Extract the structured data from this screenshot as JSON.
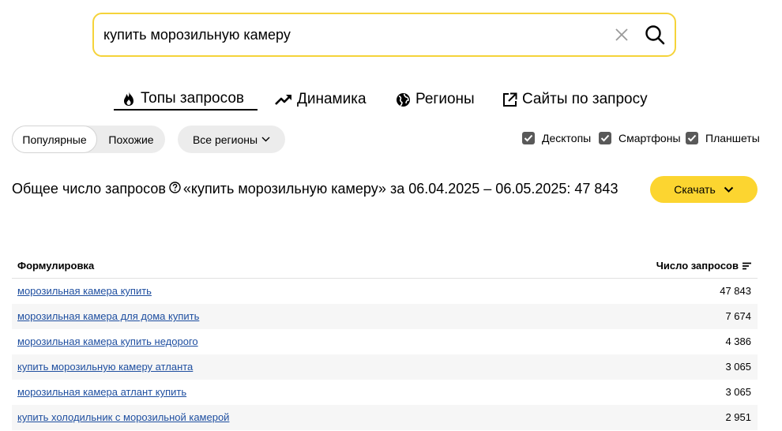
{
  "search": {
    "value": "купить морозильную камеру"
  },
  "tabs": [
    {
      "label": "Топы запросов",
      "icon": "flame-icon"
    },
    {
      "label": "Динамика",
      "icon": "trend-icon"
    },
    {
      "label": "Регионы",
      "icon": "globe-icon"
    },
    {
      "label": "Сайты по запросу",
      "icon": "external-link-icon"
    }
  ],
  "filters": {
    "popular": "Популярные",
    "similar": "Похожие",
    "regions": "Все регионы"
  },
  "devices": [
    {
      "label": "Десктопы",
      "checked": true
    },
    {
      "label": "Смартфоны",
      "checked": true
    },
    {
      "label": "Планшеты",
      "checked": true
    }
  ],
  "total": {
    "prefix": "Общее число запросов",
    "suffix": "«купить морозильную камеру» за 06.04.2025 – 06.05.2025: 47 843"
  },
  "download": {
    "label": "Скачать"
  },
  "table": {
    "col_phrase": "Формулировка",
    "col_count": "Число запросов",
    "rows": [
      {
        "phrase": "морозильная камера купить",
        "count": "47 843"
      },
      {
        "phrase": "морозильная камера для дома купить",
        "count": "7 674"
      },
      {
        "phrase": "морозильная камера купить недорого",
        "count": "4 386"
      },
      {
        "phrase": "купить морозильную камеру атланта",
        "count": "3 065"
      },
      {
        "phrase": "морозильная камера атлант купить",
        "count": "3 065"
      },
      {
        "phrase": "купить холодильник с морозильной камерой",
        "count": "2 951"
      }
    ]
  },
  "colors": {
    "accent": "#fcd530",
    "link": "#1f4fa0",
    "checkbox": "#595959"
  }
}
